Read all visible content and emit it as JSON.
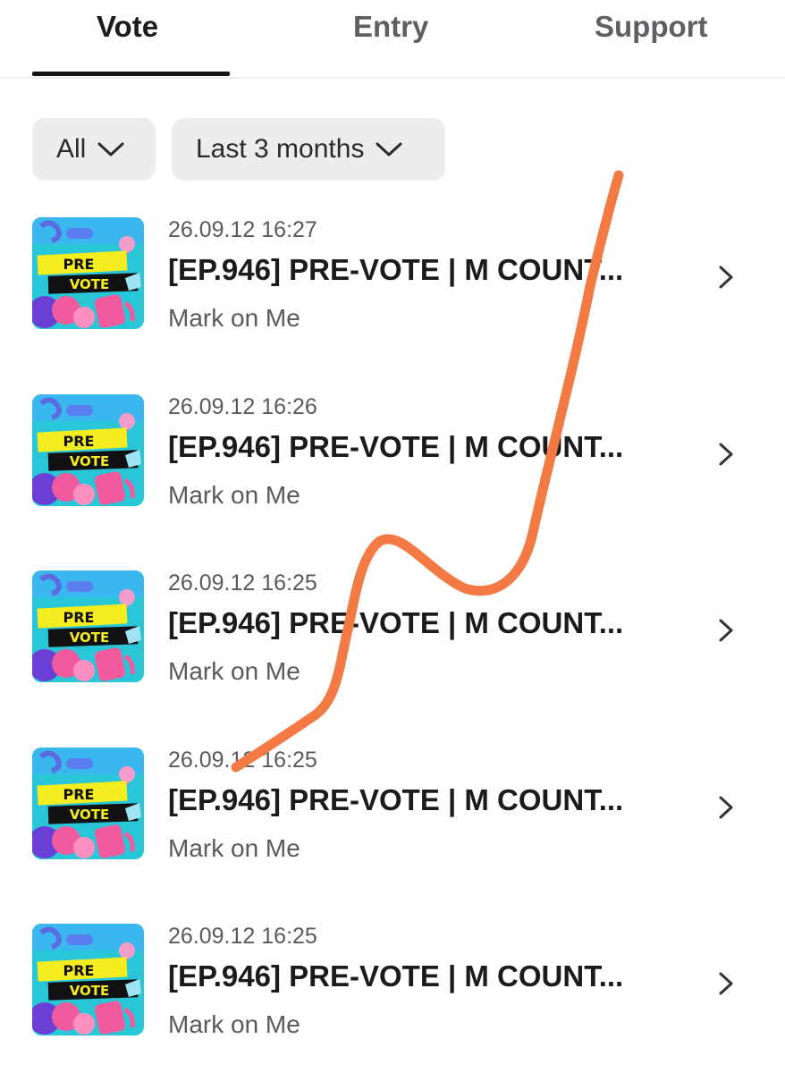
{
  "tabs": [
    {
      "label": "Vote",
      "active": true
    },
    {
      "label": "Entry",
      "active": false
    },
    {
      "label": "Support",
      "active": false
    }
  ],
  "filters": [
    {
      "label": "All",
      "icon": "chevron-down-icon"
    },
    {
      "label": "Last 3 months",
      "icon": "chevron-down-icon"
    }
  ],
  "thumbnail": {
    "line1": "PRE",
    "line2": "VOTE"
  },
  "items": [
    {
      "date": "26.09.12 16:27",
      "title": "[EP.946] PRE-VOTE | M COUNT...",
      "artist": "Mark on Me"
    },
    {
      "date": "26.09.12 16:26",
      "title": "[EP.946] PRE-VOTE | M COUNT...",
      "artist": "Mark on Me"
    },
    {
      "date": "26.09.12 16:25",
      "title": "[EP.946] PRE-VOTE | M COUNT...",
      "artist": "Mark on Me"
    },
    {
      "date": "26.09.12 16:25",
      "title": "[EP.946] PRE-VOTE | M COUNT...",
      "artist": "Mark on Me"
    },
    {
      "date": "26.09.12 16:25",
      "title": "[EP.946] PRE-VOTE | M COUNT...",
      "artist": "Mark on Me"
    }
  ],
  "colors": {
    "scribble": "#f47a45",
    "thumb_bg": "#29c6d8",
    "thumb_badge_yellow": "#f5ed1f",
    "thumb_badge_black": "#111111",
    "thumb_pink": "#f25a9e",
    "thumb_purple": "#6b3fd6"
  },
  "icons": {
    "row_arrow": "chevron-right-icon"
  }
}
